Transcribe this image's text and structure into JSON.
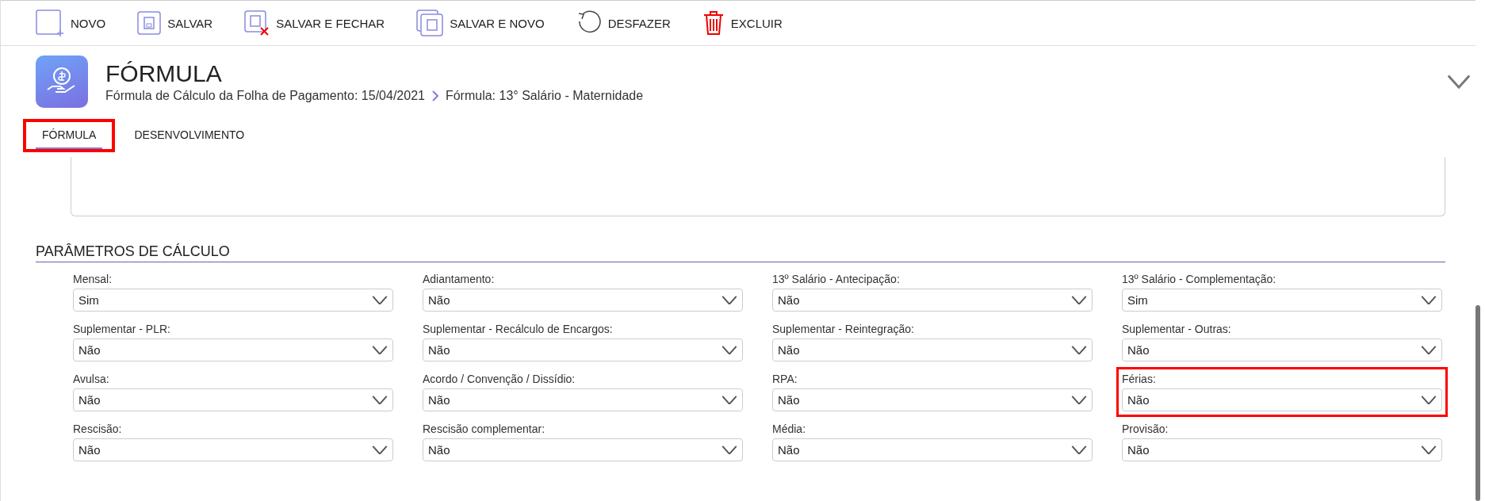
{
  "toolbar": [
    {
      "kind": "new",
      "label": "NOVO"
    },
    {
      "kind": "save",
      "label": "SALVAR"
    },
    {
      "kind": "save_close",
      "label": "SALVAR E FECHAR"
    },
    {
      "kind": "save_new",
      "label": "SALVAR E NOVO"
    },
    {
      "kind": "undo",
      "label": "DESFAZER"
    },
    {
      "kind": "delete",
      "label": "EXCLUIR"
    }
  ],
  "header": {
    "title": "FÓRMULA",
    "breadcrumb": [
      "Fórmula de Cálculo da Folha de Pagamento: 15/04/2021",
      "Fórmula: 13° Salário - Maternidade"
    ]
  },
  "tabs": [
    {
      "label": "FÓRMULA",
      "selected": true,
      "highlighted": true
    },
    {
      "label": "DESENVOLVIMENTO",
      "selected": false,
      "highlighted": false
    }
  ],
  "section": {
    "title": "PARÂMETROS DE CÁLCULO"
  },
  "fields": [
    {
      "label": "Mensal:",
      "value": "Sim",
      "highlighted": false
    },
    {
      "label": "Adiantamento:",
      "value": "Não",
      "highlighted": false
    },
    {
      "label": "13º Salário - Antecipação:",
      "value": "Não",
      "highlighted": false
    },
    {
      "label": "13º Salário - Complementação:",
      "value": "Sim",
      "highlighted": false
    },
    {
      "label": "Suplementar - PLR:",
      "value": "Não",
      "highlighted": false
    },
    {
      "label": "Suplementar - Recálculo de Encargos:",
      "value": "Não",
      "highlighted": false
    },
    {
      "label": "Suplementar - Reintegração:",
      "value": "Não",
      "highlighted": false
    },
    {
      "label": "Suplementar - Outras:",
      "value": "Não",
      "highlighted": false
    },
    {
      "label": "Avulsa:",
      "value": "Não",
      "highlighted": false
    },
    {
      "label": "Acordo / Convenção / Dissídio:",
      "value": "Não",
      "highlighted": false
    },
    {
      "label": "RPA:",
      "value": "Não",
      "highlighted": false
    },
    {
      "label": "Férias:",
      "value": "Não",
      "highlighted": true
    },
    {
      "label": "Rescisão:",
      "value": "Não",
      "highlighted": false
    },
    {
      "label": "Rescisão complementar:",
      "value": "Não",
      "highlighted": false
    },
    {
      "label": "Média:",
      "value": "Não",
      "highlighted": false
    },
    {
      "label": "Provisão:",
      "value": "Não",
      "highlighted": false
    }
  ]
}
